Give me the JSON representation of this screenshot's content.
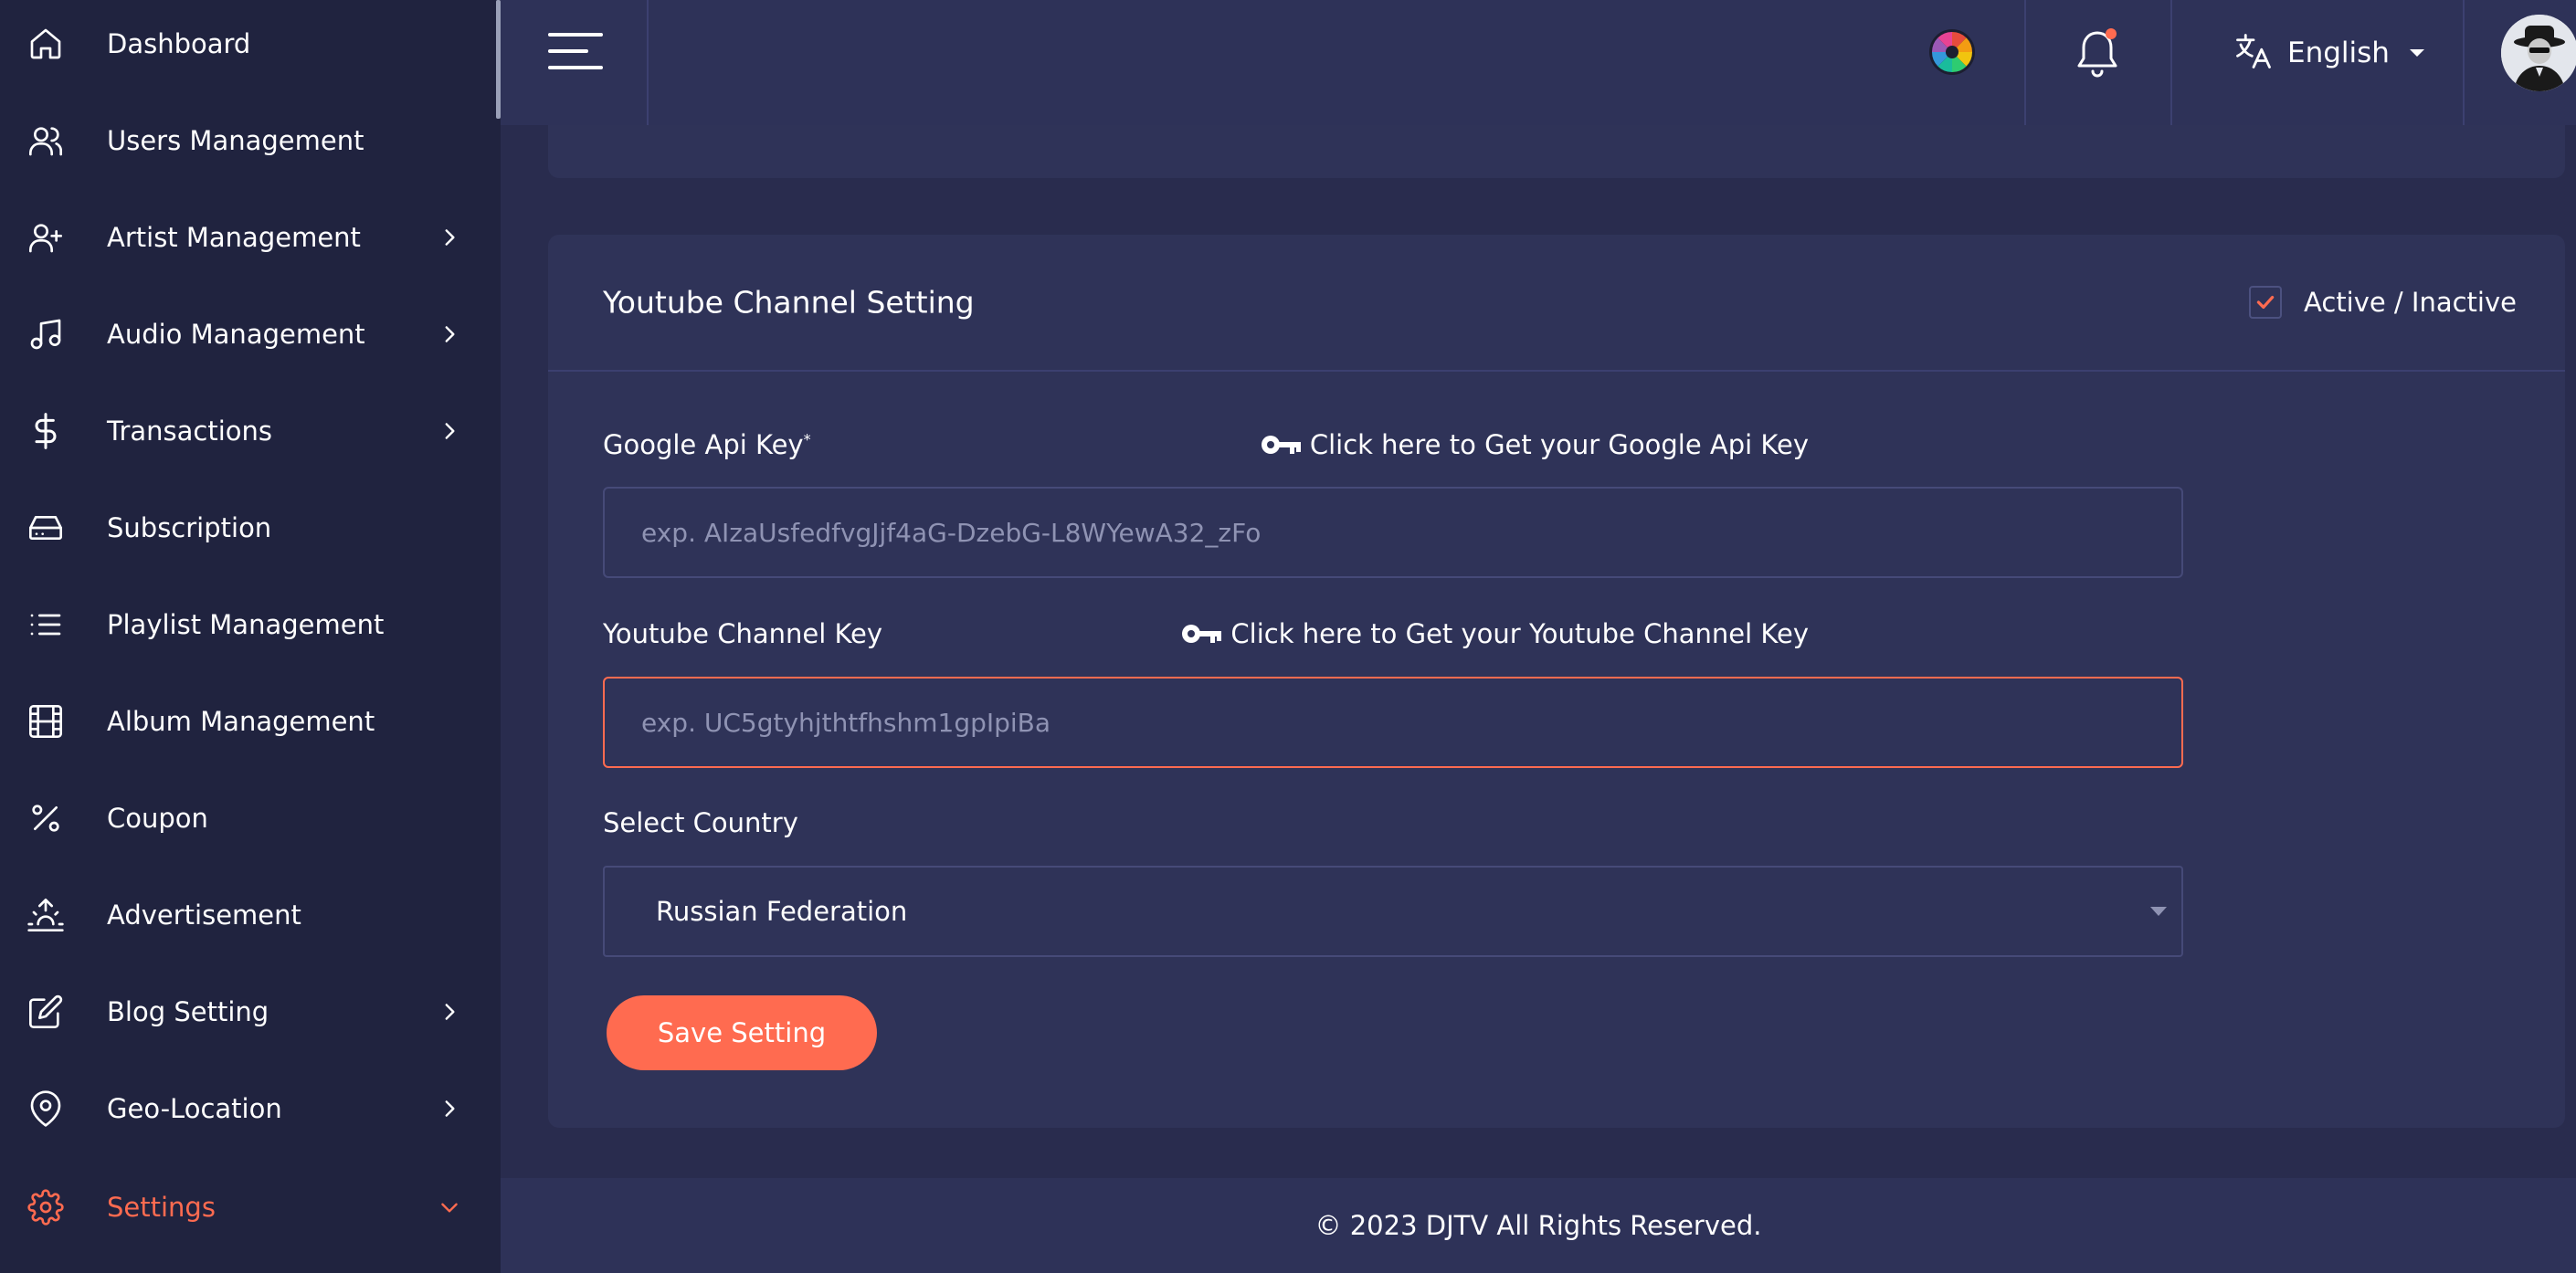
{
  "sidebar": {
    "items": [
      {
        "label": "Dashboard",
        "icon": "home-icon",
        "has_submenu": false
      },
      {
        "label": "Users Management",
        "icon": "users-icon",
        "has_submenu": false
      },
      {
        "label": "Artist Management",
        "icon": "user-plus-icon",
        "has_submenu": true
      },
      {
        "label": "Audio Management",
        "icon": "music-icon",
        "has_submenu": true
      },
      {
        "label": "Transactions",
        "icon": "dollar-icon",
        "has_submenu": true
      },
      {
        "label": "Subscription",
        "icon": "hard-drive-icon",
        "has_submenu": false
      },
      {
        "label": "Playlist Management",
        "icon": "list-icon",
        "has_submenu": false
      },
      {
        "label": "Album Management",
        "icon": "film-icon",
        "has_submenu": false
      },
      {
        "label": "Coupon",
        "icon": "percent-icon",
        "has_submenu": false
      },
      {
        "label": "Advertisement",
        "icon": "sunrise-icon",
        "has_submenu": false
      },
      {
        "label": "Blog Setting",
        "icon": "edit-icon",
        "has_submenu": true
      },
      {
        "label": "Geo-Location",
        "icon": "map-pin-icon",
        "has_submenu": true
      },
      {
        "label": "Settings",
        "icon": "gear-icon",
        "has_submenu": true,
        "active": true
      }
    ]
  },
  "header": {
    "language": "English",
    "notification_dot": true
  },
  "card": {
    "title": "Youtube Channel Setting",
    "active_label": "Active / Inactive",
    "active_checked": true,
    "google_api_key": {
      "label": "Google Api Key",
      "required_mark": "*",
      "help_link": "Click here to Get your Google Api Key",
      "placeholder": "exp. AIzaUsfedfvgJjf4aG-DzebG-L8WYewA32_zFo",
      "value": ""
    },
    "youtube_channel_key": {
      "label": "Youtube Channel Key",
      "help_link": "Click here to Get your Youtube Channel Key",
      "placeholder": "exp. UC5gtyhjthtfhshm1gpIpiBa",
      "value": ""
    },
    "country": {
      "label": "Select Country",
      "selected": "Russian Federation"
    },
    "save_label": "Save Setting"
  },
  "footer": {
    "copyright": "© 2023 DJTV All Rights Reserved."
  },
  "colors": {
    "sidebar_bg": "#20233f",
    "header_bg": "#2e3258",
    "page_bg": "#292c4e",
    "card_bg": "#2f3358",
    "accent": "#ff6b50"
  }
}
